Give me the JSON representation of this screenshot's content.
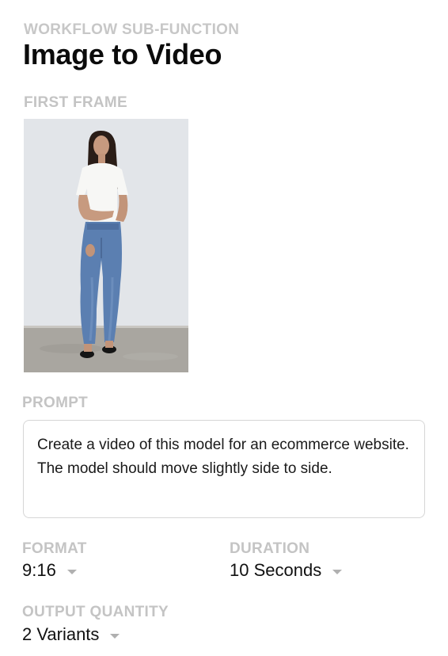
{
  "header": {
    "eyebrow": "WORKFLOW SUB-FUNCTION",
    "title": "Image to Video"
  },
  "first_frame": {
    "label": "FIRST FRAME"
  },
  "prompt": {
    "label": "PROMPT",
    "value": "Create a video of this model for an ecommerce website. The model should move slightly side to side."
  },
  "format": {
    "label": "FORMAT",
    "selected": "9:16"
  },
  "duration": {
    "label": "DURATION",
    "selected": "10 Seconds"
  },
  "output_quantity": {
    "label": "OUTPUT QUANTITY",
    "selected": "2 Variants"
  },
  "colors": {
    "label_gray": "#c4c4c4",
    "border": "#d6d6d6",
    "text": "#111111"
  }
}
